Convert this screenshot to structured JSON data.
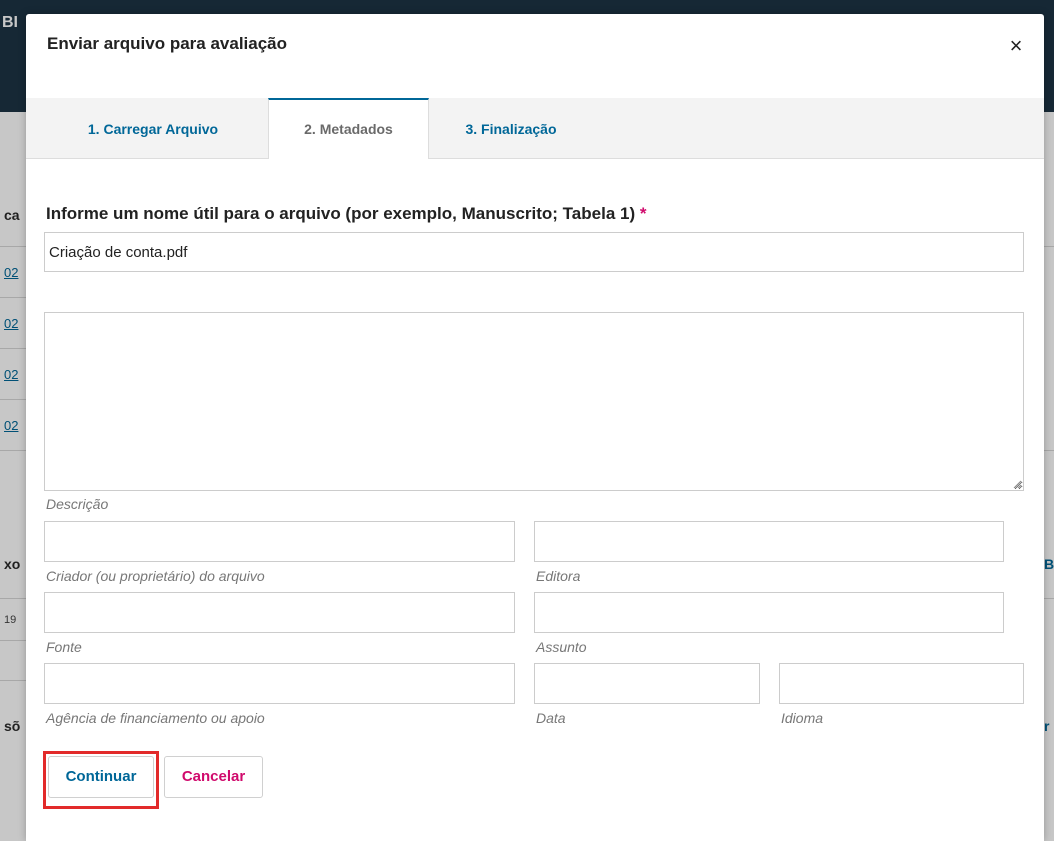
{
  "modal": {
    "title": "Enviar arquivo para avaliação",
    "close_icon": "×"
  },
  "tabs": [
    {
      "label": "1. Carregar Arquivo",
      "state": "default"
    },
    {
      "label": "2. Metadados",
      "state": "active"
    },
    {
      "label": "3. Finalização",
      "state": "default"
    }
  ],
  "form": {
    "name_label": "Informe um nome útil para o arquivo (por exemplo, Manuscrito; Tabela 1)",
    "required_mark": "*",
    "name_value": "Criação de conta.pdf",
    "description_value": "",
    "labels": {
      "description": "Descrição",
      "creator": "Criador (ou proprietário) do arquivo",
      "publisher": "Editora",
      "source": "Fonte",
      "subject": "Assunto",
      "sponsor": "Agência de financiamento ou apoio",
      "date": "Data",
      "language": "Idioma"
    }
  },
  "buttons": {
    "continue": "Continuar",
    "cancel": "Cancelar"
  },
  "background": {
    "brand_fragment": "BI",
    "left_fragments": [
      "ca",
      "xo",
      "sõ"
    ],
    "link_fragments": [
      "02",
      "02",
      "02",
      "02"
    ],
    "small_fragment": "19",
    "right_fragments": [
      "B",
      "r"
    ]
  },
  "colors": {
    "accent": "#006798",
    "required": "#d00a6c",
    "highlight": "#e22a2a",
    "header_bg": "#1d3444"
  },
  "icons": {
    "close": "close-icon",
    "resize": "resize-grip-icon"
  }
}
